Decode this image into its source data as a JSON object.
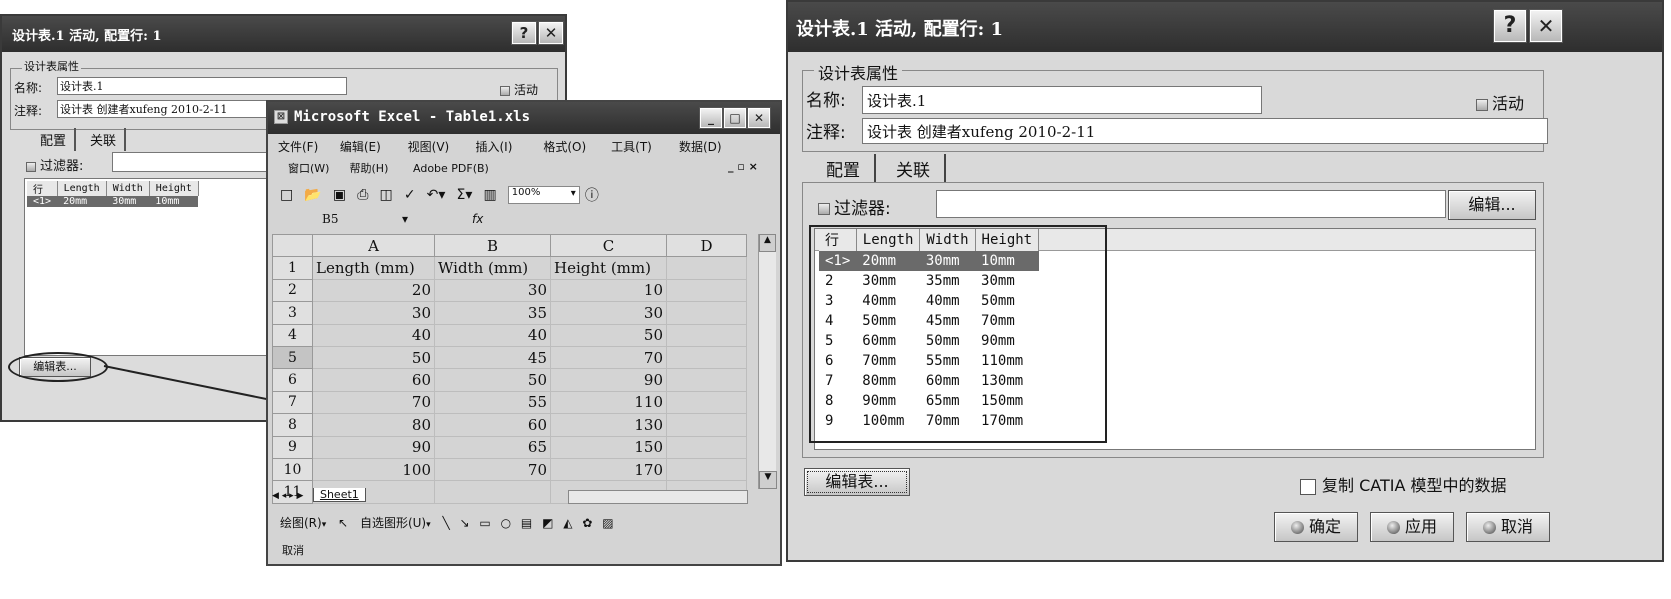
{
  "left_dialog": {
    "title": "设计表.1 活动, 配置行: 1",
    "help_btn": "?",
    "close_btn": "✕",
    "group_label": "设计表属性",
    "name_label": "名称:",
    "name_value": "设计表.1",
    "active_label": "活动",
    "comment_label": "注释:",
    "comment_value": "设计表 创建者xufeng 2010-2-11",
    "tab_config": "配置",
    "tab_link": "关联",
    "filter_label": "过滤器:",
    "columns": [
      "行",
      "Length",
      "Width",
      "Height"
    ],
    "row1": [
      "<1>",
      "20mm",
      "30mm",
      "10mm"
    ],
    "edit_table_btn": "编辑表..."
  },
  "excel": {
    "title": "Microsoft Excel - Table1.xls",
    "menu_row1": [
      "文件(F)",
      "编辑(E)",
      "视图(V)",
      "插入(I)",
      "格式(O)",
      "工具(T)",
      "数据(D)"
    ],
    "menu_row2": [
      "窗口(W)",
      "帮助(H)",
      "Adobe PDF(B)"
    ],
    "zoom": "100%",
    "name_box": "B5",
    "fx": "fx",
    "col_headers": [
      "A",
      "B",
      "C",
      "D"
    ],
    "row_numbers": [
      "1",
      "2",
      "3",
      "4",
      "5",
      "6",
      "7",
      "8",
      "9",
      "10",
      "11"
    ],
    "header_row": [
      "Length (mm)",
      "Width (mm)",
      "Height (mm)"
    ],
    "rows": [
      [
        "20",
        "30",
        "10"
      ],
      [
        "30",
        "35",
        "30"
      ],
      [
        "40",
        "40",
        "50"
      ],
      [
        "50",
        "45",
        "70"
      ],
      [
        "60",
        "50",
        "90"
      ],
      [
        "70",
        "55",
        "110"
      ],
      [
        "80",
        "60",
        "130"
      ],
      [
        "90",
        "65",
        "150"
      ],
      [
        "100",
        "70",
        "170"
      ]
    ],
    "sheet_tab": "Sheet1",
    "draw_label": "绘图(R)",
    "autoshape_label": "自选图形(U)",
    "status": "取消"
  },
  "right_dialog": {
    "title": "设计表.1 活动, 配置行: 1",
    "help_btn": "?",
    "close_btn": "✕",
    "group_label": "设计表属性",
    "name_label": "名称:",
    "name_value": "设计表.1",
    "active_label": "活动",
    "comment_label": "注释:",
    "comment_value": "设计表 创建者xufeng 2010-2-11",
    "tab_config": "配置",
    "tab_link": "关联",
    "filter_label": "过滤器:",
    "edit_btn": "编辑...",
    "columns": [
      "行",
      "Length",
      "Width",
      "Height"
    ],
    "rows": [
      [
        "<1>",
        "20mm",
        "30mm",
        "10mm"
      ],
      [
        "2",
        "30mm",
        "35mm",
        "30mm"
      ],
      [
        "3",
        "40mm",
        "40mm",
        "50mm"
      ],
      [
        "4",
        "50mm",
        "45mm",
        "70mm"
      ],
      [
        "5",
        "60mm",
        "50mm",
        "90mm"
      ],
      [
        "6",
        "70mm",
        "55mm",
        "110mm"
      ],
      [
        "7",
        "80mm",
        "60mm",
        "130mm"
      ],
      [
        "8",
        "90mm",
        "65mm",
        "150mm"
      ],
      [
        "9",
        "100mm",
        "70mm",
        "170mm"
      ]
    ],
    "edit_table_btn": "编辑表...",
    "copy_label": "复制 CATIA 模型中的数据",
    "ok_btn": "确定",
    "apply_btn": "应用",
    "cancel_btn": "取消"
  }
}
